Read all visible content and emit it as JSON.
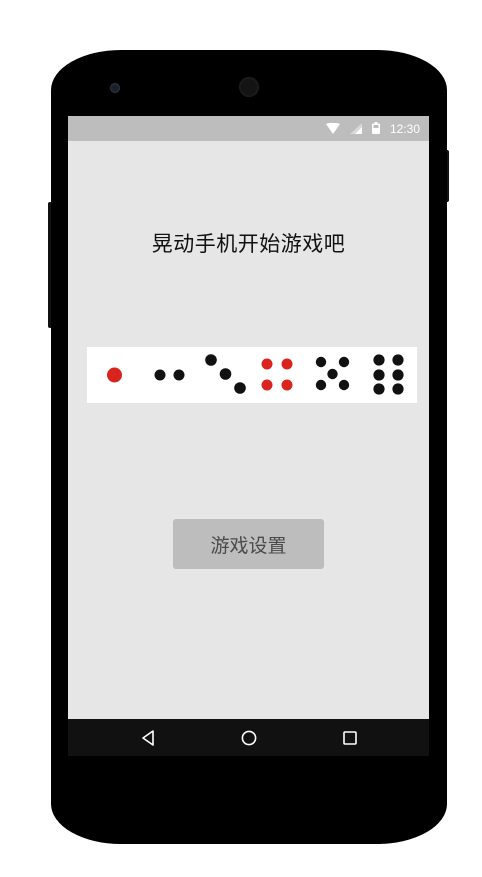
{
  "status_bar": {
    "time": "12:30",
    "icons": [
      "wifi-icon",
      "signal-icon",
      "battery-icon"
    ]
  },
  "main": {
    "title": "晃动手机开始游戏吧",
    "dice": [
      {
        "face": 1,
        "pip_color": "#d9231d"
      },
      {
        "face": 2,
        "pip_color": "#111111"
      },
      {
        "face": 3,
        "pip_color": "#111111"
      },
      {
        "face": 4,
        "pip_color": "#d9231d"
      },
      {
        "face": 5,
        "pip_color": "#111111"
      },
      {
        "face": 6,
        "pip_color": "#111111"
      }
    ],
    "settings_button_label": "游戏设置"
  },
  "nav_bar": {
    "buttons": [
      "back-icon",
      "home-icon",
      "recents-icon"
    ]
  },
  "colors": {
    "screen_background": "#e6e6e6",
    "status_bar": "#bdbdbd",
    "button": "#bdbdbd",
    "nav_bar": "#111111",
    "red_pip": "#d9231d",
    "black_pip": "#111111"
  }
}
